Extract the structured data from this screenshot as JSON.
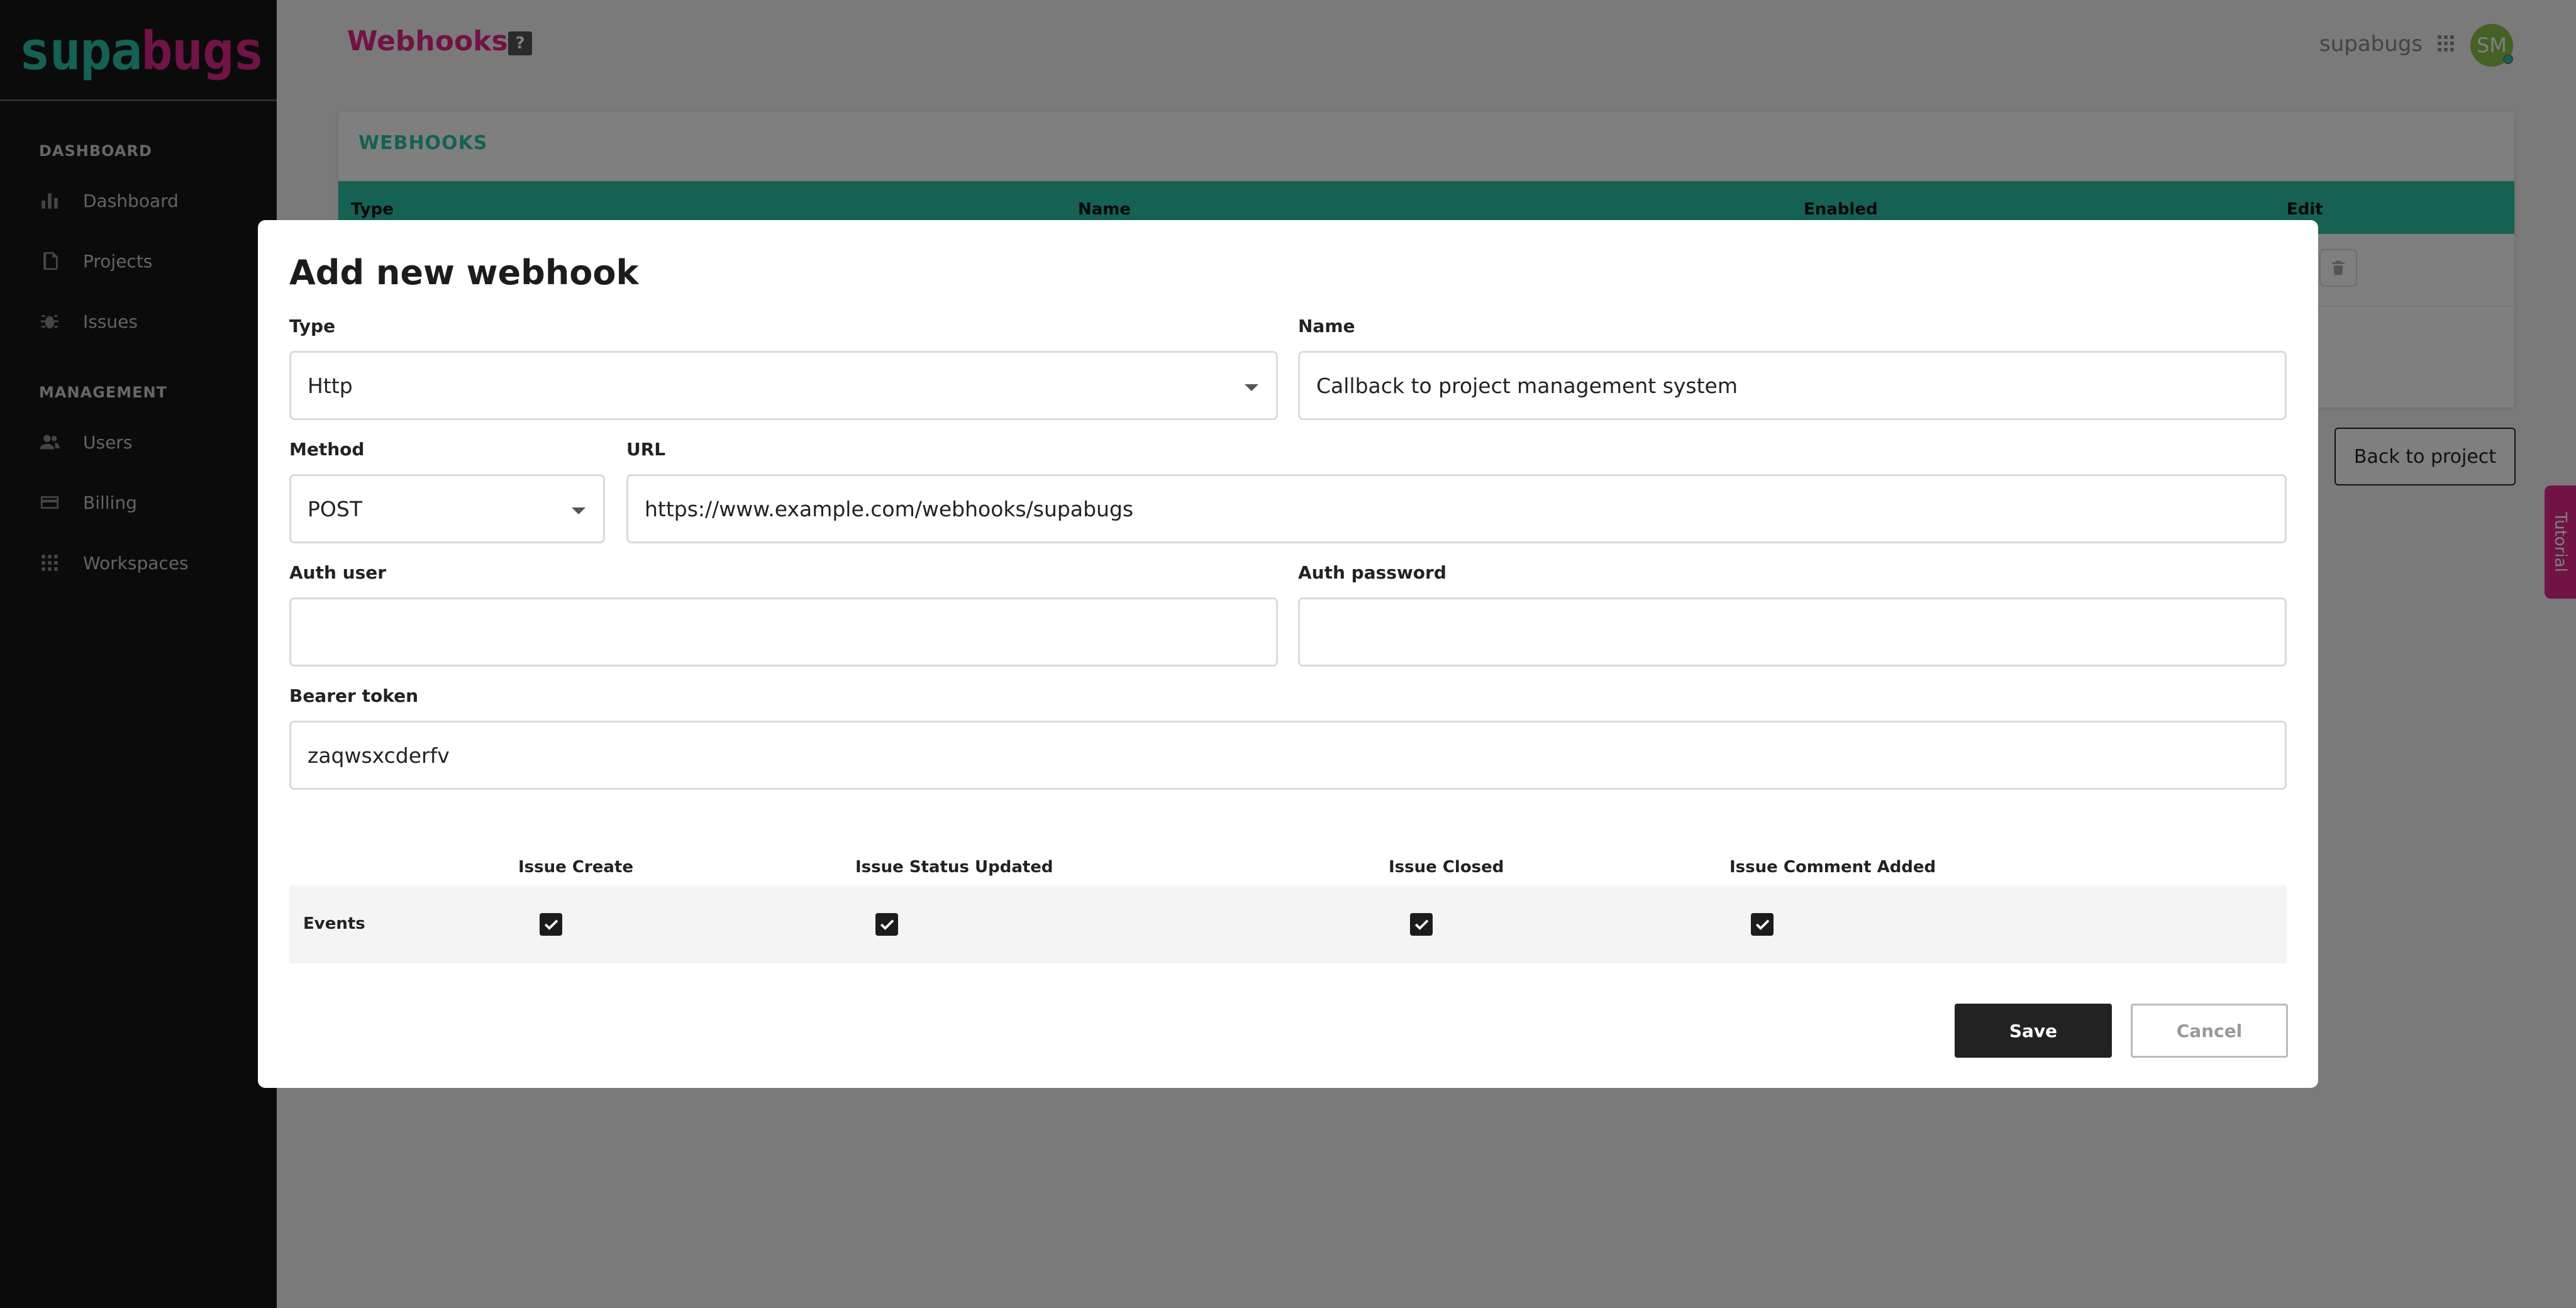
{
  "app": {
    "logo_part1": "supa",
    "logo_part2": "bugs",
    "workspace": "supabugs",
    "avatar_initials": "SM"
  },
  "sidebar": {
    "sections": [
      {
        "label": "DASHBOARD",
        "items": [
          {
            "label": "Dashboard",
            "icon": "bar-chart-icon"
          },
          {
            "label": "Projects",
            "icon": "document-icon"
          },
          {
            "label": "Issues",
            "icon": "bug-icon"
          }
        ]
      },
      {
        "label": "MANAGEMENT",
        "items": [
          {
            "label": "Users",
            "icon": "users-icon"
          },
          {
            "label": "Billing",
            "icon": "credit-card-icon"
          },
          {
            "label": "Workspaces",
            "icon": "grid-icon"
          }
        ]
      }
    ]
  },
  "header": {
    "title": "Webhooks",
    "help": "?"
  },
  "card": {
    "title": "WEBHOOKS",
    "columns": [
      "Type",
      "Name",
      "Enabled",
      "Edit"
    ]
  },
  "back_button": "Back to project",
  "tutorial": "Tutorial",
  "modal": {
    "title": "Add new webhook",
    "type": {
      "label": "Type",
      "value": "Http"
    },
    "name": {
      "label": "Name",
      "value": "Callback to project management system"
    },
    "method": {
      "label": "Method",
      "value": "POST"
    },
    "url": {
      "label": "URL",
      "value": "https://www.example.com/webhooks/supabugs"
    },
    "auth_user": {
      "label": "Auth user",
      "value": ""
    },
    "auth_password": {
      "label": "Auth password",
      "value": ""
    },
    "bearer_token": {
      "label": "Bearer token",
      "value": "zaqwsxcderfv"
    },
    "events": {
      "row_label": "Events",
      "columns": [
        "Issue Create",
        "Issue Status Updated",
        "Issue Closed",
        "Issue Comment Added"
      ],
      "checked": [
        true,
        true,
        true,
        true
      ]
    },
    "save": "Save",
    "cancel": "Cancel"
  },
  "colors": {
    "brand_teal": "#2ac2a7",
    "brand_pink": "#e2278a",
    "sidebar_bg": "#161616"
  }
}
